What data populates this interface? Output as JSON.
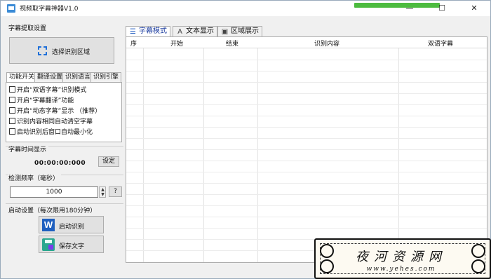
{
  "titlebar": {
    "title": "视频取字幕神器V1.0",
    "min": "—",
    "max": "☐",
    "close": "✕"
  },
  "left": {
    "extract_group": "字幕提取设置",
    "select_region_button": "选择识别区域",
    "tabs": [
      "功能开关",
      "翻译设置",
      "识别语言",
      "识别引擎"
    ],
    "options": [
      "开启“双语字幕”识别模式",
      "开启“字幕翻译”功能",
      "开启“动态字幕”显示  （推荐）",
      "识别内容相同自动清空字幕",
      "启动识别后窗口自动最小化"
    ],
    "time_group": "字幕时间显示",
    "time_value": "00:00:00:000",
    "set_button": "设定",
    "freq_group": "检测频率（毫秒）",
    "freq_value": "1000",
    "help_button": "?",
    "start_group": "启动设置（每次限用180分钟）",
    "start_button": "启动识别",
    "save_button": "保存文字",
    "word_icon_letter": "W"
  },
  "right": {
    "tabs": [
      "字幕模式",
      "文本显示",
      "区域展示"
    ],
    "columns": [
      "序",
      "开始",
      "结束",
      "识别内容",
      "双语字幕"
    ]
  },
  "watermark": {
    "title": "夜河资源网",
    "url": "www.yehes.com"
  }
}
